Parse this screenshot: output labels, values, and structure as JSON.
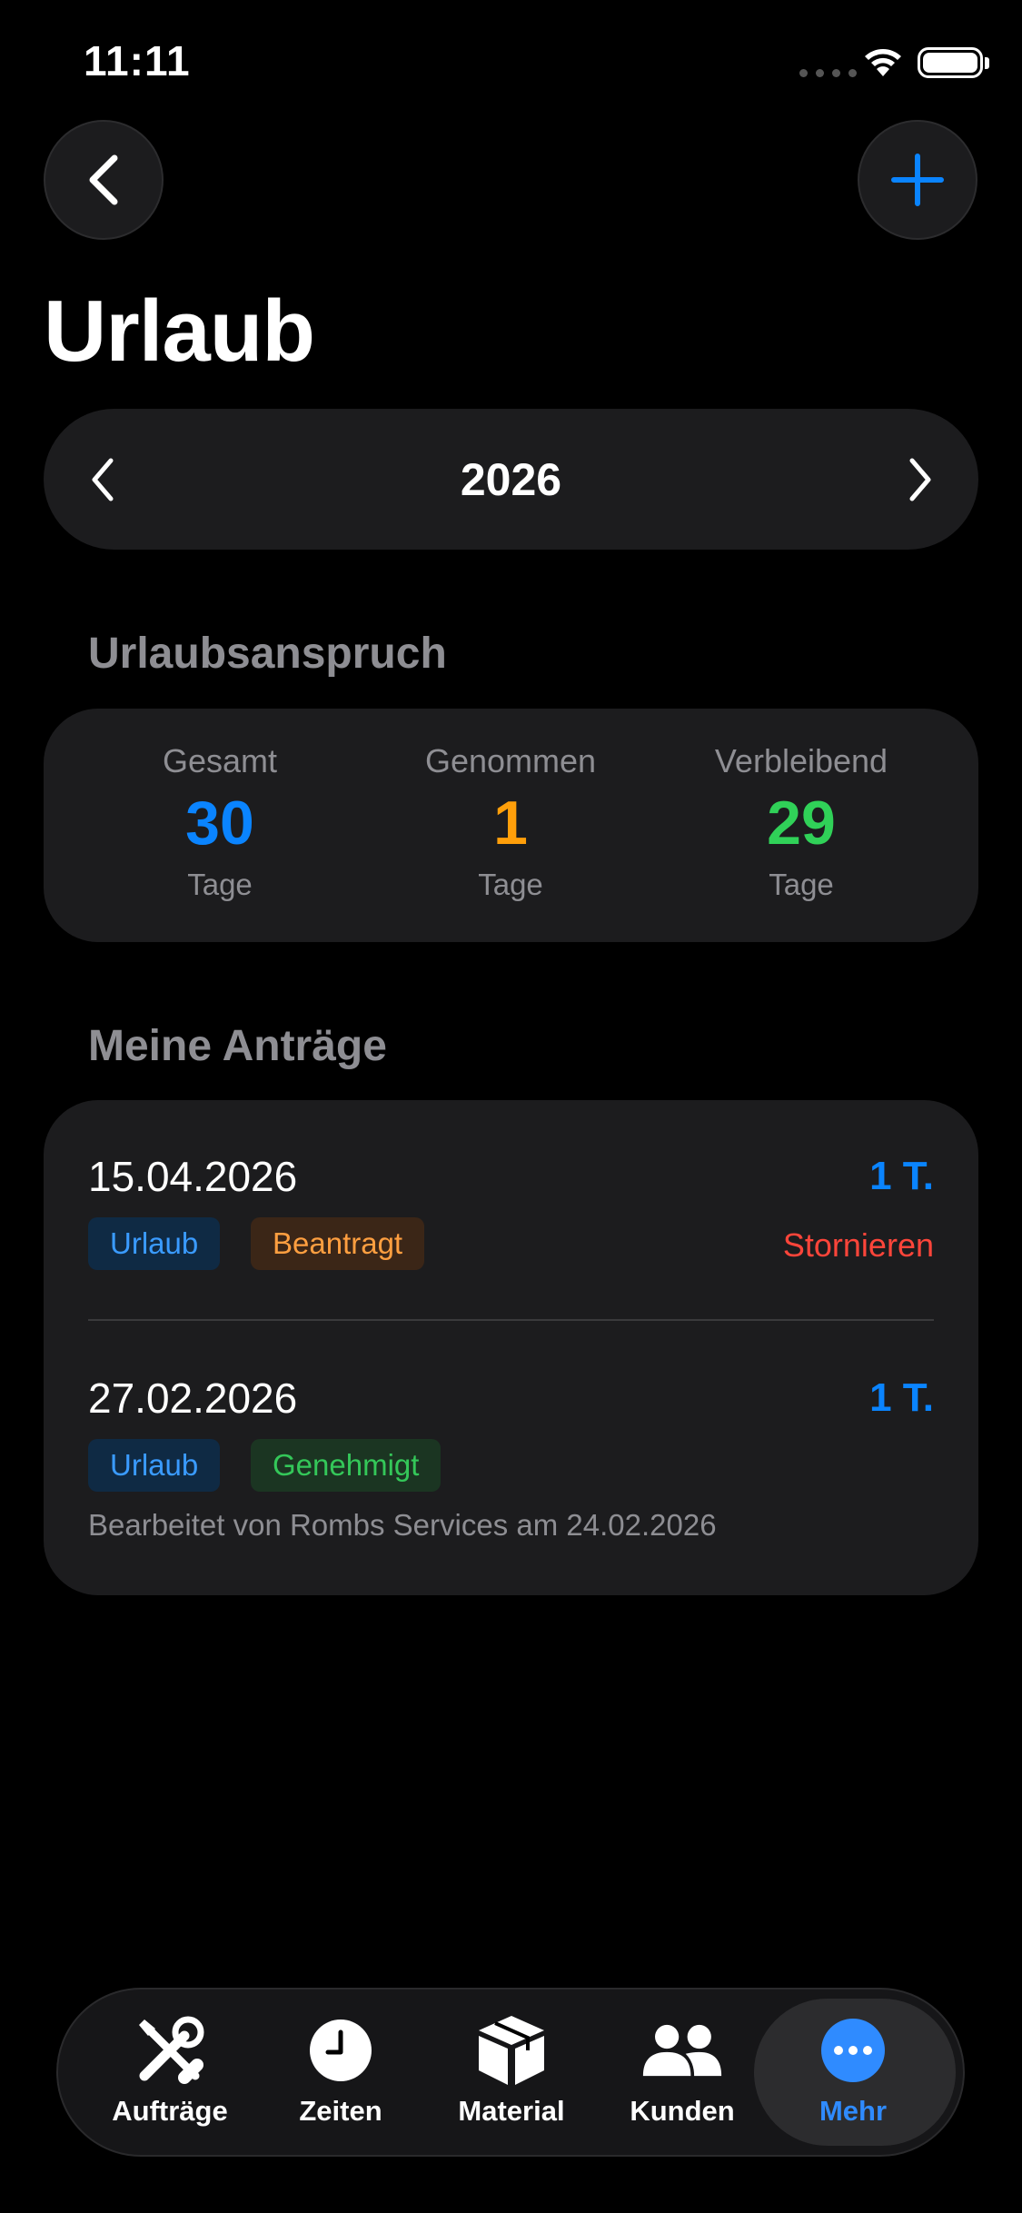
{
  "status_bar": {
    "time": "11:11"
  },
  "header": {
    "title": "Urlaub"
  },
  "year_selector": {
    "year": "2026"
  },
  "entitlement": {
    "section_title": "Urlaubsanspruch",
    "columns": [
      {
        "label": "Gesamt",
        "value": "30",
        "unit": "Tage",
        "color": "#0a84ff"
      },
      {
        "label": "Genommen",
        "value": "1",
        "unit": "Tage",
        "color": "#ff9f0a"
      },
      {
        "label": "Verbleibend",
        "value": "29",
        "unit": "Tage",
        "color": "#30d158"
      }
    ]
  },
  "requests": {
    "section_title": "Meine Anträge",
    "items": [
      {
        "date": "15.04.2026",
        "days": "1 T.",
        "type": "Urlaub",
        "status": "Beantragt",
        "action": "Stornieren"
      },
      {
        "date": "27.02.2026",
        "days": "1 T.",
        "type": "Urlaub",
        "status": "Genehmigt",
        "note": "Bearbeitet von Rombs Services am 24.02.2026"
      }
    ]
  },
  "tabbar": {
    "items": [
      {
        "label": "Aufträge",
        "icon": "tools-icon"
      },
      {
        "label": "Zeiten",
        "icon": "clock-icon"
      },
      {
        "label": "Material",
        "icon": "box-icon"
      },
      {
        "label": "Kunden",
        "icon": "people-icon"
      },
      {
        "label": "Mehr",
        "icon": "more-icon",
        "active": true
      }
    ]
  },
  "colors": {
    "accent": "#0a84ff",
    "background": "#000000",
    "card": "#1c1c1e",
    "destructive": "#ff453a"
  }
}
